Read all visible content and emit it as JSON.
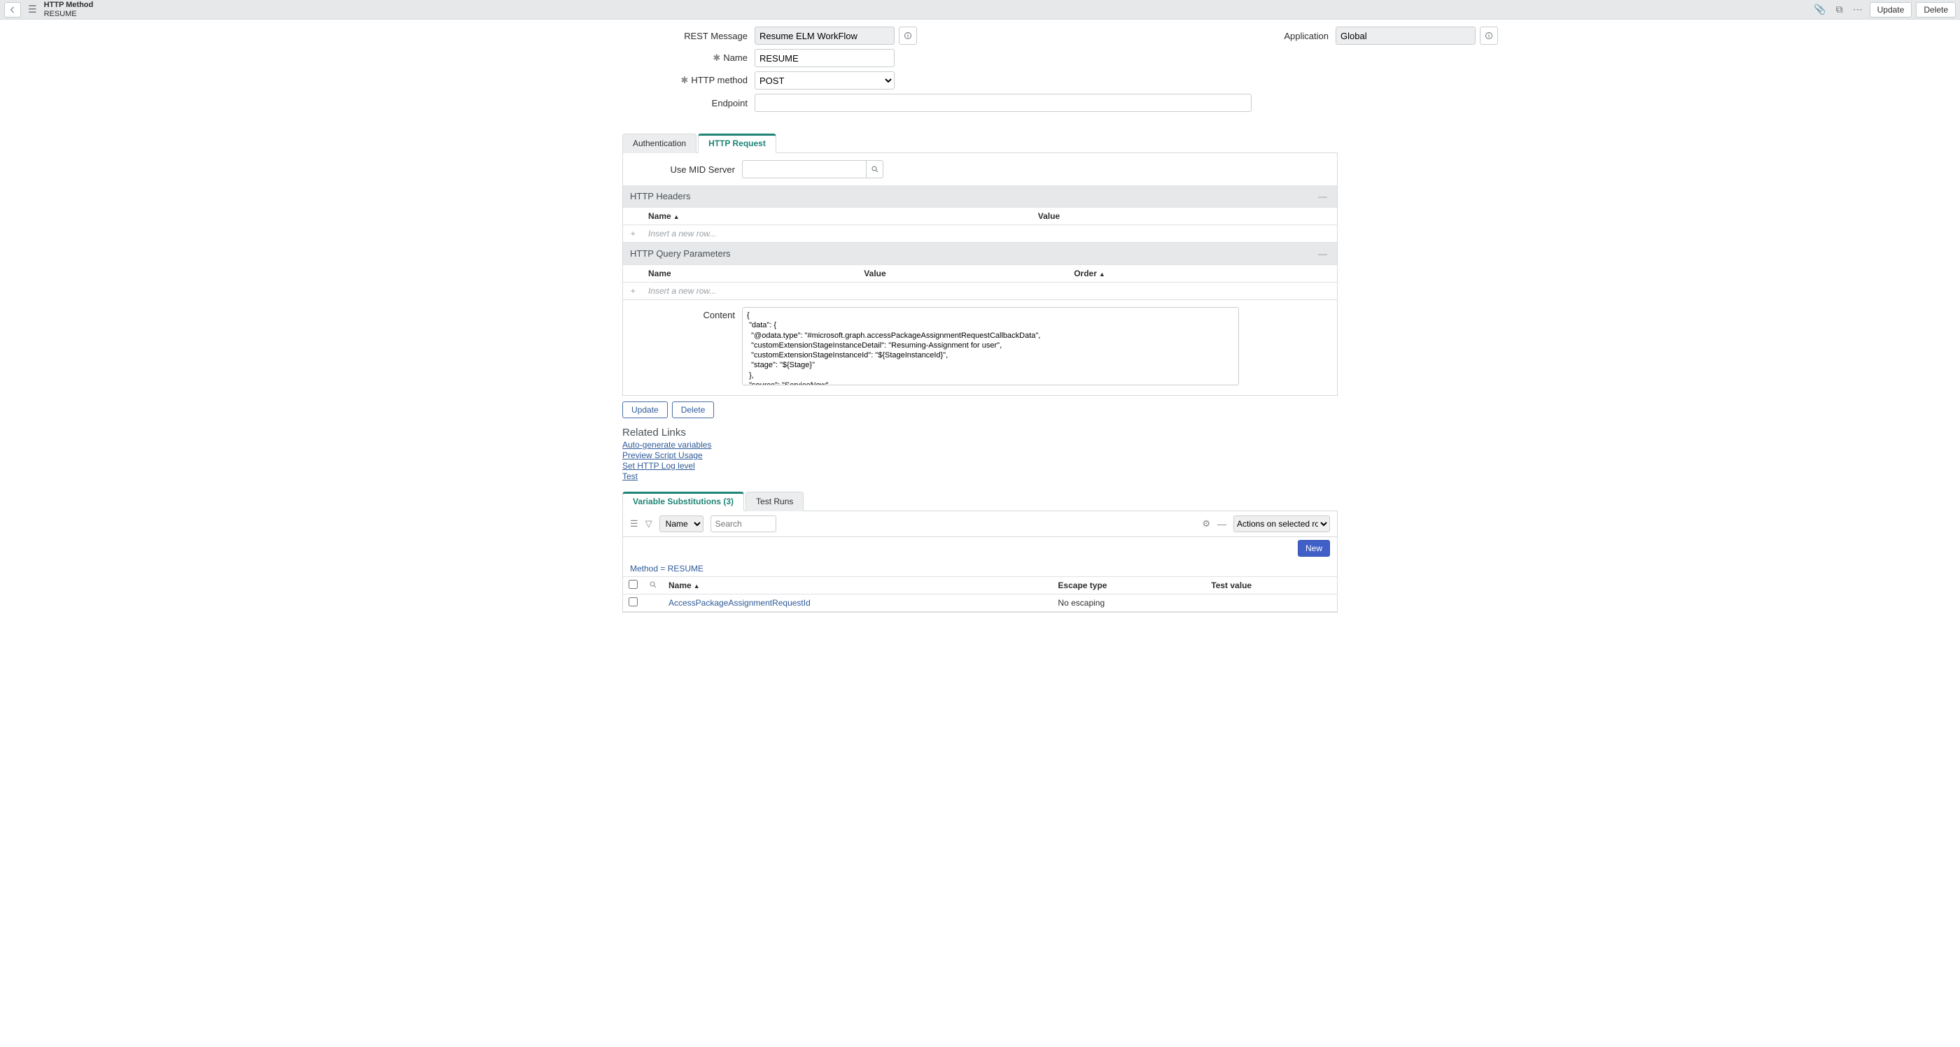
{
  "header": {
    "title_top": "HTTP Method",
    "title_sub": "RESUME",
    "update_label": "Update",
    "delete_label": "Delete"
  },
  "form": {
    "rest_message_label": "REST Message",
    "rest_message_value": "Resume ELM WorkFlow",
    "application_label": "Application",
    "application_value": "Global",
    "name_label": "Name",
    "name_value": "RESUME",
    "method_label": "HTTP method",
    "method_value": "POST",
    "endpoint_label": "Endpoint",
    "endpoint_value": ""
  },
  "tabs": {
    "auth": "Authentication",
    "http_request": "HTTP Request"
  },
  "mid": {
    "label": "Use MID Server",
    "value": ""
  },
  "headers_section": {
    "title": "HTTP Headers",
    "col_name": "Name",
    "col_value": "Value",
    "insert_placeholder": "Insert a new row..."
  },
  "query_section": {
    "title": "HTTP Query Parameters",
    "col_name": "Name",
    "col_value": "Value",
    "col_order": "Order",
    "insert_placeholder": "Insert a new row..."
  },
  "content": {
    "label": "Content",
    "value": "{\n \"data\": {\n  \"@odata.type\": \"#microsoft.graph.accessPackageAssignmentRequestCallbackData\",\n  \"customExtensionStageInstanceDetail\": \"Resuming-Assignment for user\",\n  \"customExtensionStageInstanceId\": \"${StageInstanceId}\",\n  \"stage\": \"${Stage}\"\n },\n \"source\": \"ServiceNow\",\n \"type\": \"microsoft.graph.accessPackageCustomExtensionStage.${Stage}\"\n}"
  },
  "actions": {
    "update": "Update",
    "delete": "Delete"
  },
  "related": {
    "header": "Related Links",
    "autogen": "Auto-generate variables",
    "preview": "Preview Script Usage",
    "loglevel": "Set HTTP Log level",
    "test": "Test"
  },
  "lower_tabs": {
    "varsub": "Variable Substitutions (3)",
    "testruns": "Test Runs"
  },
  "list_toolbar": {
    "field_select": "Name",
    "search_placeholder": "Search",
    "actions_placeholder": "Actions on selected rows...",
    "new_label": "New"
  },
  "breadcrumb": "Method = RESUME",
  "vartbl": {
    "col_name": "Name",
    "col_escape": "Escape type",
    "col_testval": "Test value",
    "rows": [
      {
        "name": "AccessPackageAssignmentRequestId",
        "escape": "No escaping",
        "testval": ""
      }
    ]
  }
}
